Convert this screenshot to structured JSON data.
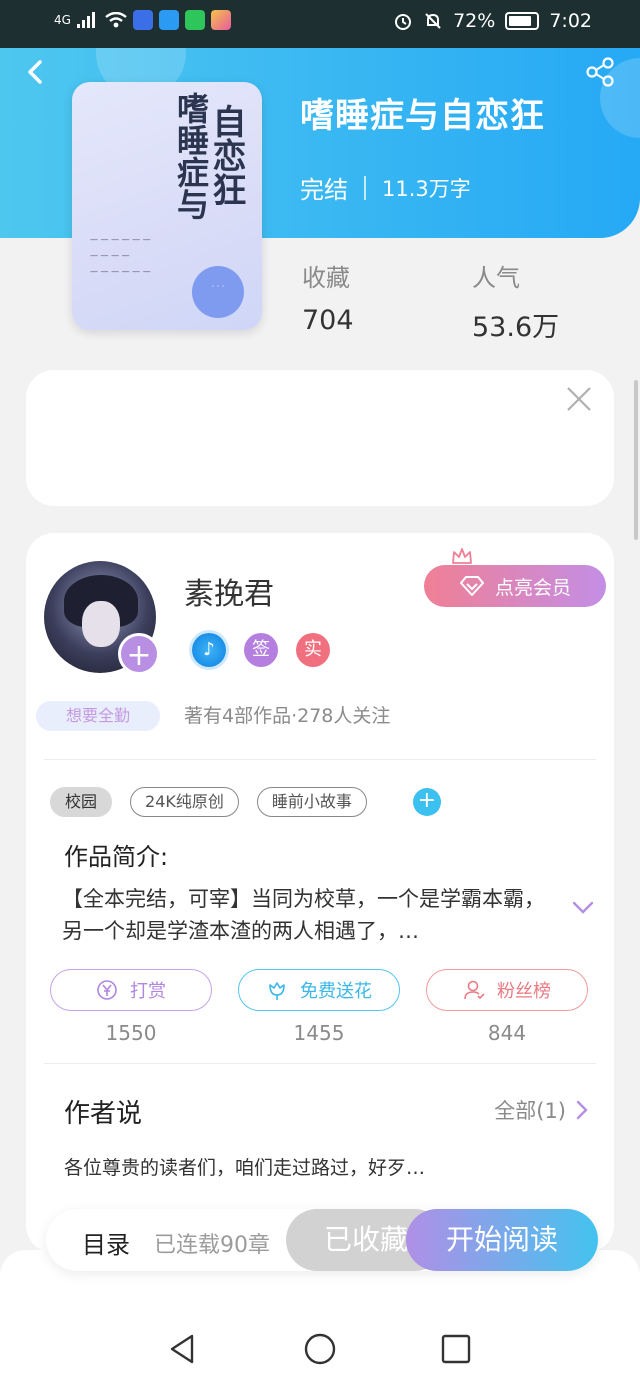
{
  "status_bar": {
    "network": "4G",
    "battery": "72%",
    "time": "7:02"
  },
  "book": {
    "title": "嗜睡症与自恋狂",
    "status": "完结",
    "words": "11.3万字",
    "cover_title_a": "自恋狂",
    "cover_title_b": "嗜睡症与"
  },
  "stats": {
    "favorites_label": "收藏",
    "favorites_value": "704",
    "popularity_label": "人气",
    "popularity_value": "53.6万"
  },
  "author": {
    "name": "素挽君",
    "member_button": "点亮会员",
    "badges": [
      "签",
      "实"
    ],
    "qqj_tag": "想要全勤",
    "stats_text": "著有4部作品·278人关注"
  },
  "tags": [
    "校园",
    "24K纯原创",
    "睡前小故事"
  ],
  "intro": {
    "heading": "作品简介:",
    "text": "【全本完结，可宰】当同为校草，一个是学霸本霸，另一个却是学渣本渣的两人相遇了，…"
  },
  "actions": [
    {
      "label": "打赏",
      "count": "1550"
    },
    {
      "label": "免费送花",
      "count": "1455"
    },
    {
      "label": "粉丝榜",
      "count": "844"
    }
  ],
  "author_says": {
    "heading": "作者说",
    "all_label": "全部(1)",
    "text": "各位尊贵的读者们，咱们走过路过，好歹…"
  },
  "bottom_bar": {
    "toc": "目录",
    "serial": "已连载90章",
    "collected": "已收藏",
    "read": "开始阅读"
  },
  "colors": {
    "header_start": "#4ec7ef",
    "header_end": "#26a9f5",
    "member_start": "#f07f95",
    "member_end": "#c38ee6",
    "read_start": "#b08fe6",
    "read_end": "#43c3ef"
  }
}
